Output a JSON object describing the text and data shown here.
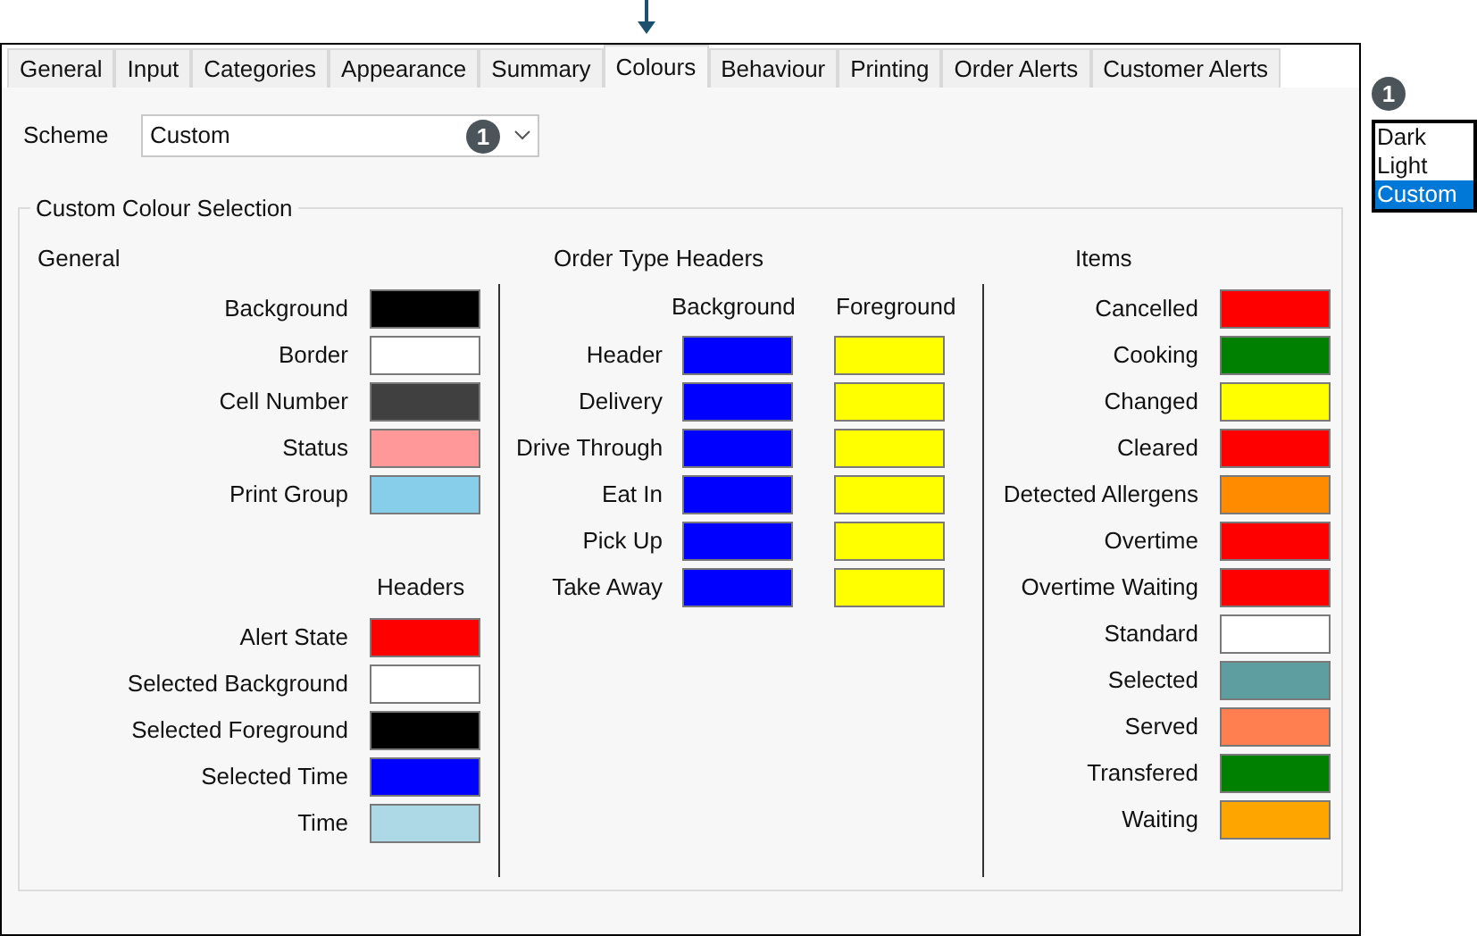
{
  "tabs": [
    {
      "label": "General",
      "selected": false
    },
    {
      "label": "Input",
      "selected": false
    },
    {
      "label": "Categories",
      "selected": false
    },
    {
      "label": "Appearance",
      "selected": false
    },
    {
      "label": "Summary",
      "selected": false
    },
    {
      "label": "Colours",
      "selected": true
    },
    {
      "label": "Behaviour",
      "selected": false
    },
    {
      "label": "Printing",
      "selected": false
    },
    {
      "label": "Order Alerts",
      "selected": false
    },
    {
      "label": "Customer Alerts",
      "selected": false
    }
  ],
  "scheme": {
    "label": "Scheme",
    "value": "Custom",
    "badge": "1"
  },
  "group_title": "Custom Colour Selection",
  "general": {
    "heading": "General",
    "rows": [
      {
        "label": "Background",
        "color": "#000000"
      },
      {
        "label": "Border",
        "color": "#ffffff"
      },
      {
        "label": "Cell Number",
        "color": "#404040"
      },
      {
        "label": "Status",
        "color": "#ff9999"
      },
      {
        "label": "Print Group",
        "color": "#87ceeb"
      }
    ],
    "headers_heading": "Headers",
    "header_rows": [
      {
        "label": "Alert State",
        "color": "#ff0000"
      },
      {
        "label": "Selected Background",
        "color": "#ffffff"
      },
      {
        "label": "Selected Foreground",
        "color": "#000000"
      },
      {
        "label": "Selected Time",
        "color": "#0000ff"
      },
      {
        "label": "Time",
        "color": "#add8e6"
      }
    ]
  },
  "order_type_headers": {
    "heading": "Order Type Headers",
    "columns": [
      "Background",
      "Foreground"
    ],
    "rows": [
      {
        "label": "Header",
        "swatches": [
          {
            "color": "#0000ff"
          },
          {
            "color": "#ffff00"
          }
        ]
      },
      {
        "label": "Delivery",
        "swatches": [
          {
            "color": "#0000ff"
          },
          {
            "color": "#ffff00"
          }
        ]
      },
      {
        "label": "Drive Through",
        "swatches": [
          {
            "color": "#0000ff"
          },
          {
            "color": "#ffff00"
          }
        ]
      },
      {
        "label": "Eat In",
        "swatches": [
          {
            "color": "#0000ff"
          },
          {
            "color": "#ffff00"
          }
        ]
      },
      {
        "label": "Pick Up",
        "swatches": [
          {
            "color": "#0000ff"
          },
          {
            "color": "#ffff00"
          }
        ]
      },
      {
        "label": "Take Away",
        "swatches": [
          {
            "color": "#0000ff"
          },
          {
            "color": "#ffff00"
          }
        ]
      }
    ]
  },
  "items": {
    "heading": "Items",
    "rows": [
      {
        "label": "Cancelled",
        "color": "#ff0000"
      },
      {
        "label": "Cooking",
        "color": "#008000"
      },
      {
        "label": "Changed",
        "color": "#ffff00"
      },
      {
        "label": "Cleared",
        "color": "#ff0000"
      },
      {
        "label": "Detected Allergens",
        "color": "#ff8c00"
      },
      {
        "label": "Overtime",
        "color": "#ff0000"
      },
      {
        "label": "Overtime Waiting",
        "color": "#ff0000"
      },
      {
        "label": "Standard",
        "color": "#ffffff"
      },
      {
        "label": "Selected",
        "color": "#5f9ea0"
      },
      {
        "label": "Served",
        "color": "#ff7f50"
      },
      {
        "label": "Transfered",
        "color": "#008000"
      },
      {
        "label": "Waiting",
        "color": "#ffa500"
      }
    ]
  },
  "callout": {
    "badge": "1",
    "options": [
      {
        "label": "Dark",
        "selected": false
      },
      {
        "label": "Light",
        "selected": false
      },
      {
        "label": "Custom",
        "selected": true
      }
    ]
  }
}
